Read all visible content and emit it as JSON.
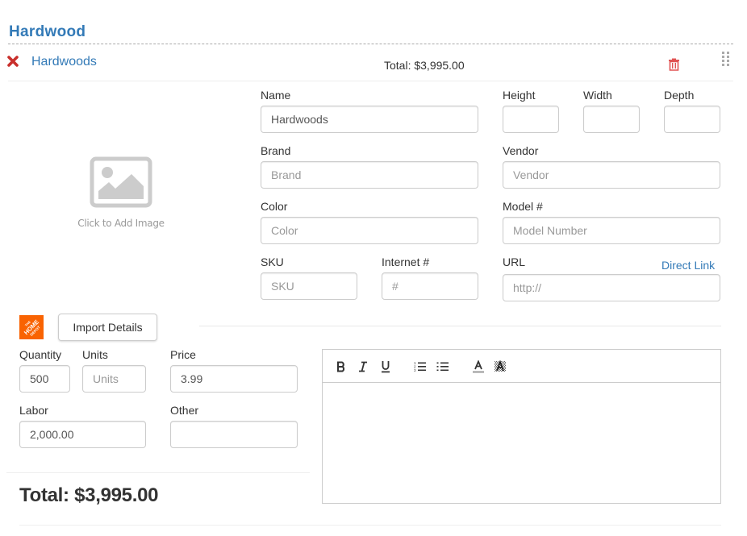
{
  "section": {
    "title": "Hardwood"
  },
  "item": {
    "name": "Hardwoods",
    "total_label": "Total: $3,995.00",
    "icons": {
      "remove": "remove-x-icon",
      "delete": "trash-icon",
      "drag": "drag-handle-icon"
    }
  },
  "image": {
    "caption": "Click to Add Image",
    "icon": "image-placeholder-icon"
  },
  "fields": {
    "name": {
      "label": "Name",
      "value": "Hardwoods",
      "placeholder": ""
    },
    "height": {
      "label": "Height",
      "value": ""
    },
    "width": {
      "label": "Width",
      "value": ""
    },
    "depth": {
      "label": "Depth",
      "value": ""
    },
    "brand": {
      "label": "Brand",
      "value": "",
      "placeholder": "Brand"
    },
    "vendor": {
      "label": "Vendor",
      "value": "",
      "placeholder": "Vendor"
    },
    "color": {
      "label": "Color",
      "value": "",
      "placeholder": "Color"
    },
    "model": {
      "label": "Model #",
      "value": "",
      "placeholder": "Model Number"
    },
    "sku": {
      "label": "SKU",
      "value": "",
      "placeholder": "SKU"
    },
    "internet": {
      "label": "Internet #",
      "value": "",
      "placeholder": "#"
    },
    "url": {
      "label": "URL",
      "value": "",
      "placeholder": "http://",
      "link_label": "Direct Link"
    },
    "quantity": {
      "label": "Quantity",
      "value": "500"
    },
    "units": {
      "label": "Units",
      "value": "",
      "placeholder": "Units"
    },
    "price": {
      "label": "Price",
      "value": "3.99"
    },
    "labor": {
      "label": "Labor",
      "value": "2,000.00"
    },
    "other": {
      "label": "Other",
      "value": ""
    }
  },
  "import": {
    "button_label": "Import Details",
    "logo": "home-depot-logo",
    "logo_color": "#f96302"
  },
  "editor": {
    "toolbar": [
      "bold",
      "italic",
      "underline",
      "ordered-list",
      "unordered-list",
      "font-color",
      "background-color"
    ],
    "content": ""
  },
  "grand_total": "Total: $3,995.00",
  "colors": {
    "accent": "#337ab7",
    "danger": "#d9534f",
    "remove": "#c9302c"
  }
}
